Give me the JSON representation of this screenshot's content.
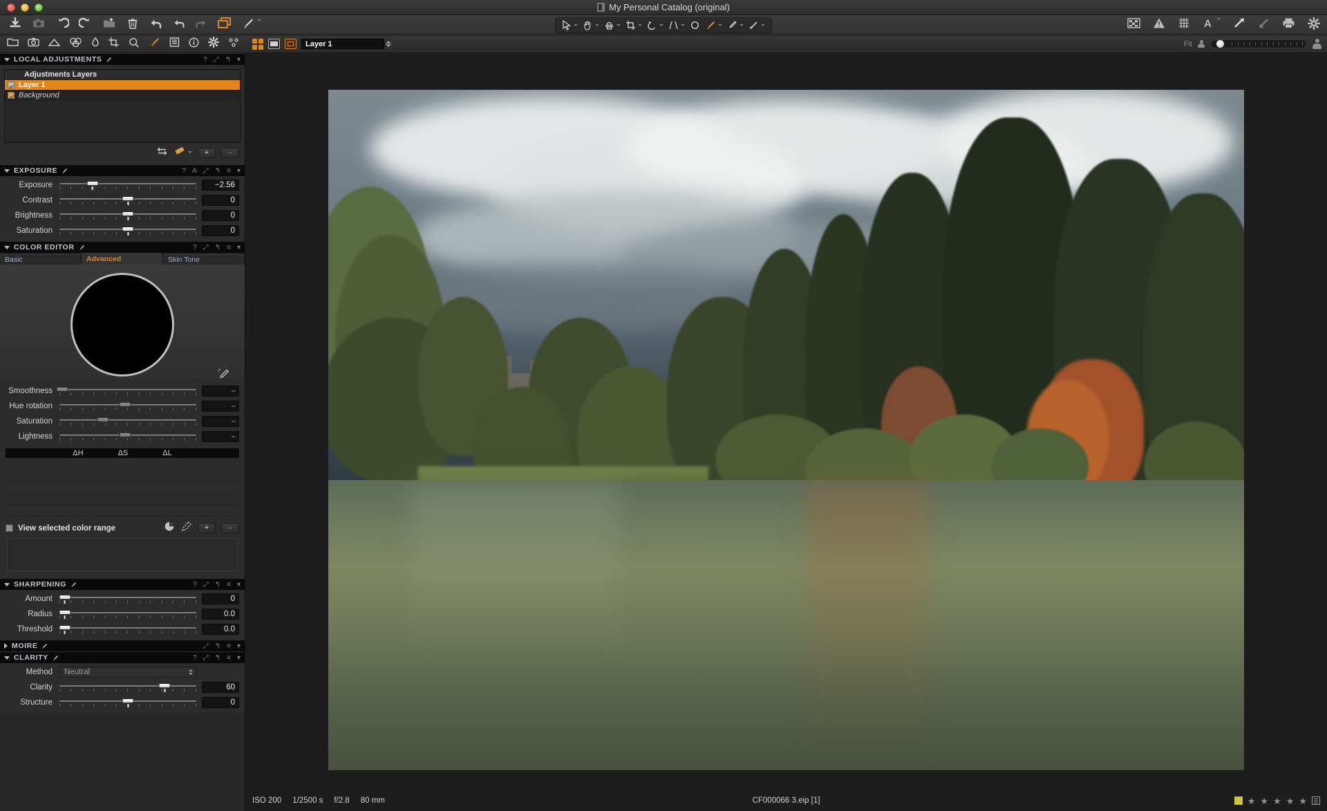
{
  "window": {
    "title": "My Personal Catalog (original)",
    "traffic_lights": [
      "close",
      "minimize",
      "zoom"
    ]
  },
  "main_toolbar": {
    "left_icons": [
      "import-icon",
      "capture-icon",
      "undo-arrow-icon",
      "redo-arrow-icon",
      "export-icon",
      "trash-icon",
      "undo-icon",
      "back-arrow-icon",
      "forward-arrow-icon",
      "copy-layers-icon",
      "brush-icon"
    ],
    "center_tools": [
      "cursor-tool",
      "pan-tool",
      "stamp-tool",
      "crop-tool",
      "rotate-tool",
      "keystone-tool",
      "ellipse-tool",
      "draw-mask-tool",
      "color-picker-tool",
      "gradient-tool"
    ],
    "active_center_tool": "draw-mask-tool",
    "right_icons": [
      "proof-icon",
      "warning-icon",
      "grid-icon",
      "text-icon",
      "arrow-up-icon",
      "arrow-down-icon",
      "print-icon",
      "gear-icon"
    ]
  },
  "tool_tabs": {
    "icons": [
      "folder-icon",
      "camera-icon",
      "lens-icon",
      "color-icon",
      "exposure-icon",
      "crop-icon",
      "details-icon",
      "local-adjustments-icon",
      "metadata-icon",
      "info-icon",
      "gear-icon",
      "batch-icon"
    ],
    "active_icon": "local-adjustments-icon",
    "view_modes": [
      "grid-view",
      "single-view",
      "layer-view"
    ],
    "active_view_mode": "layer-view",
    "layer_field_value": "Layer 1",
    "zoom_label": "Fit"
  },
  "local_adjustments": {
    "title": "LOCAL ADJUSTMENTS",
    "header_actions": [
      "help",
      "expand",
      "reset",
      "menu"
    ],
    "layers_header": "Adjustments Layers",
    "layers": [
      {
        "name": "Layer 1",
        "checked": true,
        "selected": true
      },
      {
        "name": "Background",
        "checked": true,
        "selected": false
      }
    ],
    "toolbar": {
      "invert_label": "invert-mask-icon",
      "eraser_label": "eraser-icon",
      "add_label": "+",
      "remove_label": "–"
    }
  },
  "exposure": {
    "title": "EXPOSURE",
    "sliders": [
      {
        "label": "Exposure",
        "value": "−2.56",
        "pos": 24
      },
      {
        "label": "Contrast",
        "value": "0",
        "pos": 50
      },
      {
        "label": "Brightness",
        "value": "0",
        "pos": 50
      },
      {
        "label": "Saturation",
        "value": "0",
        "pos": 50
      }
    ]
  },
  "color_editor": {
    "title": "COLOR EDITOR",
    "tabs": [
      {
        "label": "Basic",
        "active": false
      },
      {
        "label": "Advanced",
        "active": true
      },
      {
        "label": "Skin Tone",
        "active": false
      }
    ],
    "sliders": [
      {
        "label": "Smoothness",
        "value": "--",
        "pos": 2
      },
      {
        "label": "Hue rotation",
        "value": "--",
        "pos": 48
      },
      {
        "label": "Saturation",
        "value": "--",
        "pos": 32
      },
      {
        "label": "Lightness",
        "value": "--",
        "pos": 48
      }
    ],
    "delta_columns": [
      "ΔH",
      "ΔS",
      "ΔL"
    ],
    "view_selected_color_range": "View selected color range",
    "view_range_checked": false,
    "range_actions": [
      "pie-icon",
      "picker-icon",
      "+",
      "–"
    ]
  },
  "sharpening": {
    "title": "SHARPENING",
    "sliders": [
      {
        "label": "Amount",
        "value": "0",
        "pos": 3
      },
      {
        "label": "Radius",
        "value": "0.0",
        "pos": 3
      },
      {
        "label": "Threshold",
        "value": "0.0",
        "pos": 3
      }
    ]
  },
  "moire": {
    "title": "MOIRE",
    "collapsed": true
  },
  "clarity": {
    "title": "CLARITY",
    "method_label": "Method",
    "method_value": "Neutral",
    "sliders": [
      {
        "label": "Clarity",
        "value": "60",
        "pos": 77
      },
      {
        "label": "Structure",
        "value": "0",
        "pos": 50
      }
    ]
  },
  "status_bar": {
    "iso": "ISO 200",
    "shutter": "1/2500 s",
    "aperture": "f/2.8",
    "focal": "80 mm",
    "filename": "CF000066 3.eip [1]",
    "color_tag": "#cfc83a",
    "stars": 5,
    "rating_filled": 0
  },
  "colors": {
    "accent": "#e2861c",
    "panel_bg": "#2c2c2c",
    "header_bg": "#0a0a0a",
    "viewer_bg": "#1d1d1d"
  }
}
